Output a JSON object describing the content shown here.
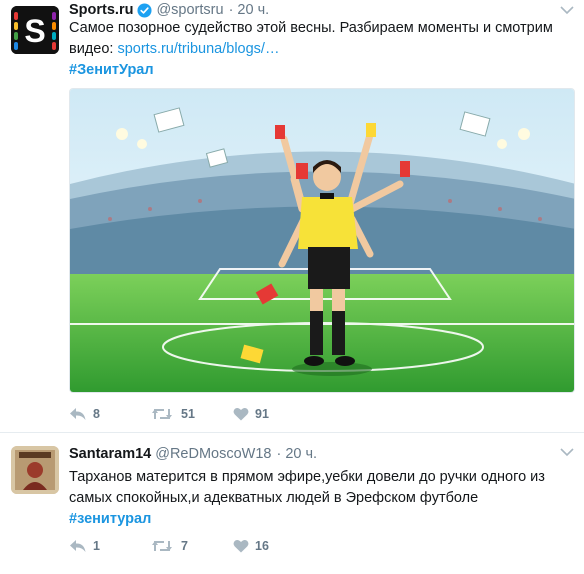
{
  "tweets": [
    {
      "name": "Sports.ru",
      "handle": "@sportsru",
      "time": "20 ч.",
      "text": "Самое позорное судейство этой весны. Разбираем моменты и смотрим видео: ",
      "link": "sports.ru/tribuna/blogs/…",
      "hashtag": "#ЗенитУрал",
      "replies": "8",
      "retweets": "51",
      "likes": "91",
      "avatar_letter": "S"
    },
    {
      "name": "Santaram14",
      "handle": "@ReDMoscoW18",
      "time": "20 ч.",
      "text": "Тарханов матерится в прямом эфире,уебки довели до ручки одного из самых спокойных,и адекватных людей в Эрефском футболе",
      "hashtag": "#зенитурал",
      "replies": "1",
      "retweets": "7",
      "likes": "16"
    }
  ],
  "colors": {
    "accent": "#1b95e0",
    "muted": "#657786",
    "verified": "#1da1f2",
    "pitch": "#3fae3a"
  }
}
